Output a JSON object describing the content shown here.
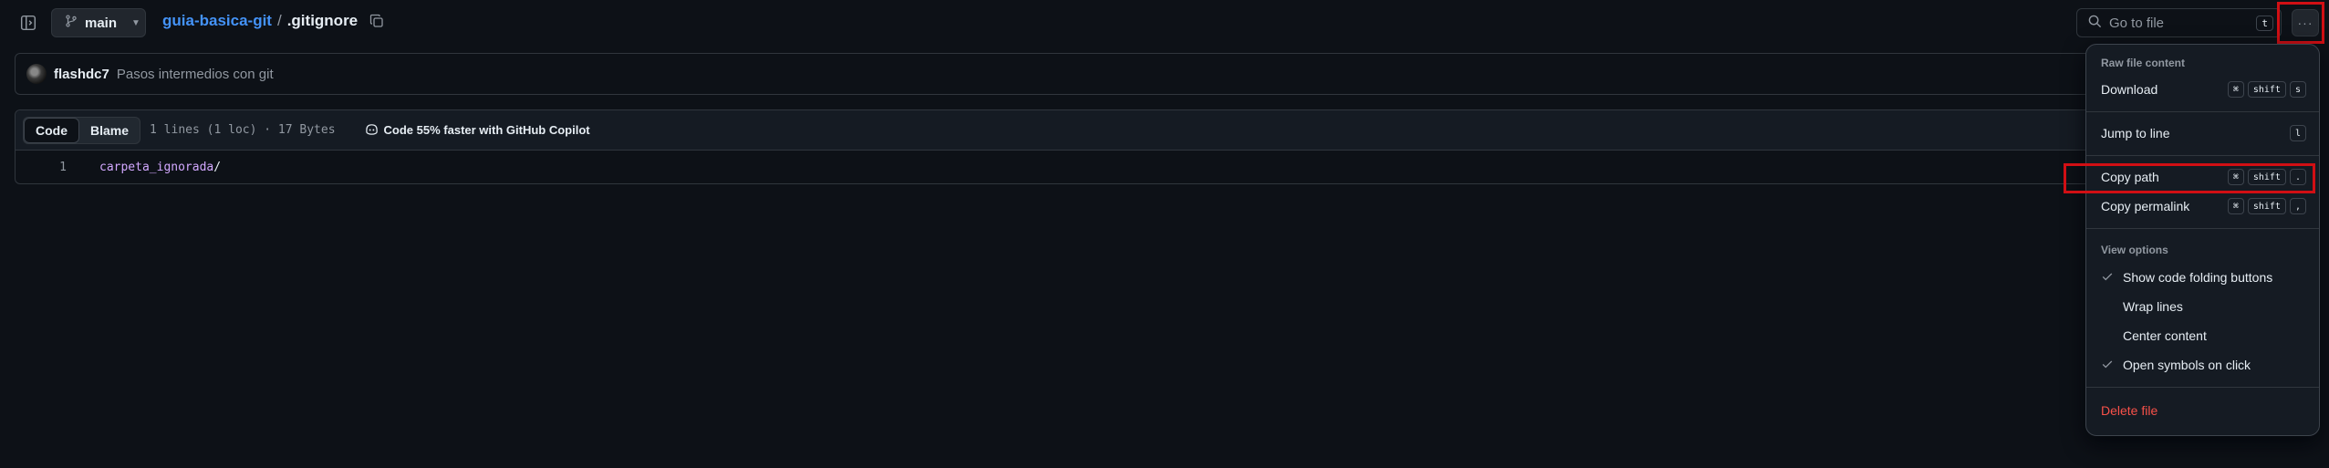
{
  "header": {
    "branch": "main",
    "repo": "guia-basica-git",
    "separator": "/",
    "file": ".gitignore",
    "goto_placeholder": "Go to file",
    "goto_shortcut": "t",
    "more_label": "···"
  },
  "commit": {
    "author": "flashdc7",
    "message": "Pasos intermedios con git"
  },
  "file": {
    "tabs": [
      "Code",
      "Blame"
    ],
    "info": "1 lines (1 loc) · 17 Bytes",
    "copilot": "Code 55% faster with GitHub Copilot",
    "lines": [
      {
        "number": "1",
        "content": "carpeta_ignorada",
        "suffix": "/"
      }
    ]
  },
  "menu": {
    "raw_title": "Raw file content",
    "download": "Download",
    "download_keys": [
      "⌘",
      "shift",
      "s"
    ],
    "jump": "Jump to line",
    "jump_keys": [
      "l"
    ],
    "copy_path": "Copy path",
    "copy_path_keys": [
      "⌘",
      "shift",
      "."
    ],
    "copy_permalink": "Copy permalink",
    "copy_permalink_keys": [
      "⌘",
      "shift",
      ","
    ],
    "view_title": "View options",
    "show_folding": "Show code folding buttons",
    "wrap": "Wrap lines",
    "center": "Center content",
    "open_symbols": "Open symbols on click",
    "delete": "Delete file"
  },
  "colors": {
    "background": "#0d1117",
    "link": "#4493f8",
    "danger": "#f85149",
    "annotation": "#d10f14"
  }
}
